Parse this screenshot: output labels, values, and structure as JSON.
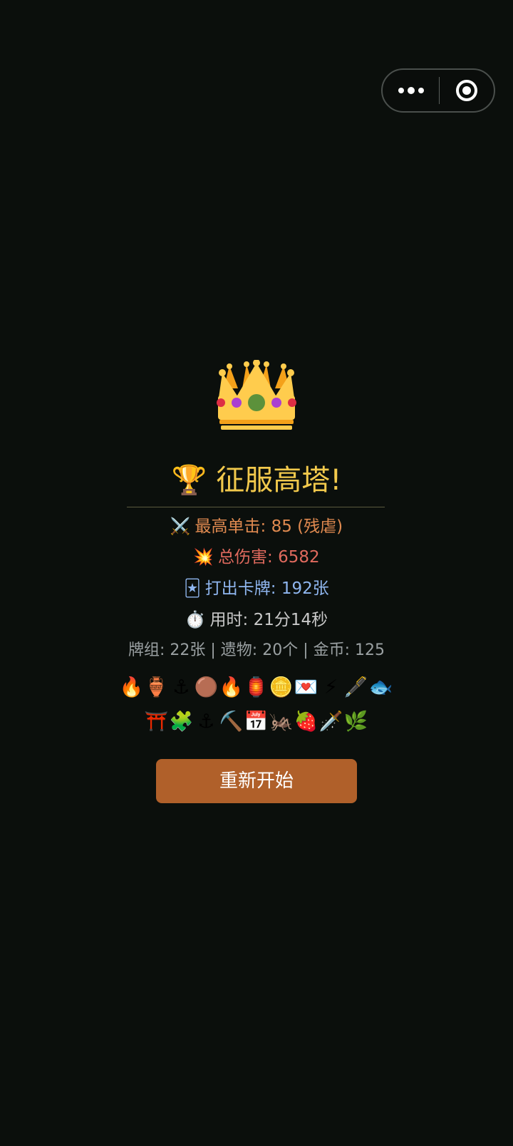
{
  "capsule": {
    "more_icon": "more-dots-icon",
    "close_icon": "target-circle-icon"
  },
  "hero": {
    "icon": "crown-icon"
  },
  "title": {
    "emoji": "🏆",
    "text": "征服高塔!"
  },
  "stats": {
    "max_hit": {
      "emoji": "⚔️",
      "text": "最高单击: 85 (残虐)"
    },
    "total_damage": {
      "emoji": "💥",
      "text": "总伤害: 6582"
    },
    "cards_played": {
      "emoji": "🃏",
      "text": "打出卡牌: 192张"
    },
    "time_used": {
      "emoji": "⏱️",
      "text": "用时: 21分14秒"
    },
    "summary": "牌组: 22张 | 遗物: 20个 | 金币: 125"
  },
  "relics": {
    "row1": [
      "🔥",
      "🏺",
      "⚓",
      "🟤",
      "🔥",
      "🏮",
      "🪙",
      "💌",
      "⚡",
      "🖋️",
      "🐟"
    ],
    "row2": [
      "⛩️",
      "🧩",
      "⚓",
      "⛏️",
      "📅",
      "🦗",
      "🍓",
      "🗡️",
      "🌿"
    ]
  },
  "actions": {
    "restart_label": "重新开始"
  },
  "colors": {
    "background": "#0b0f0c",
    "title": "#f2c94c",
    "button": "#b0602a"
  }
}
